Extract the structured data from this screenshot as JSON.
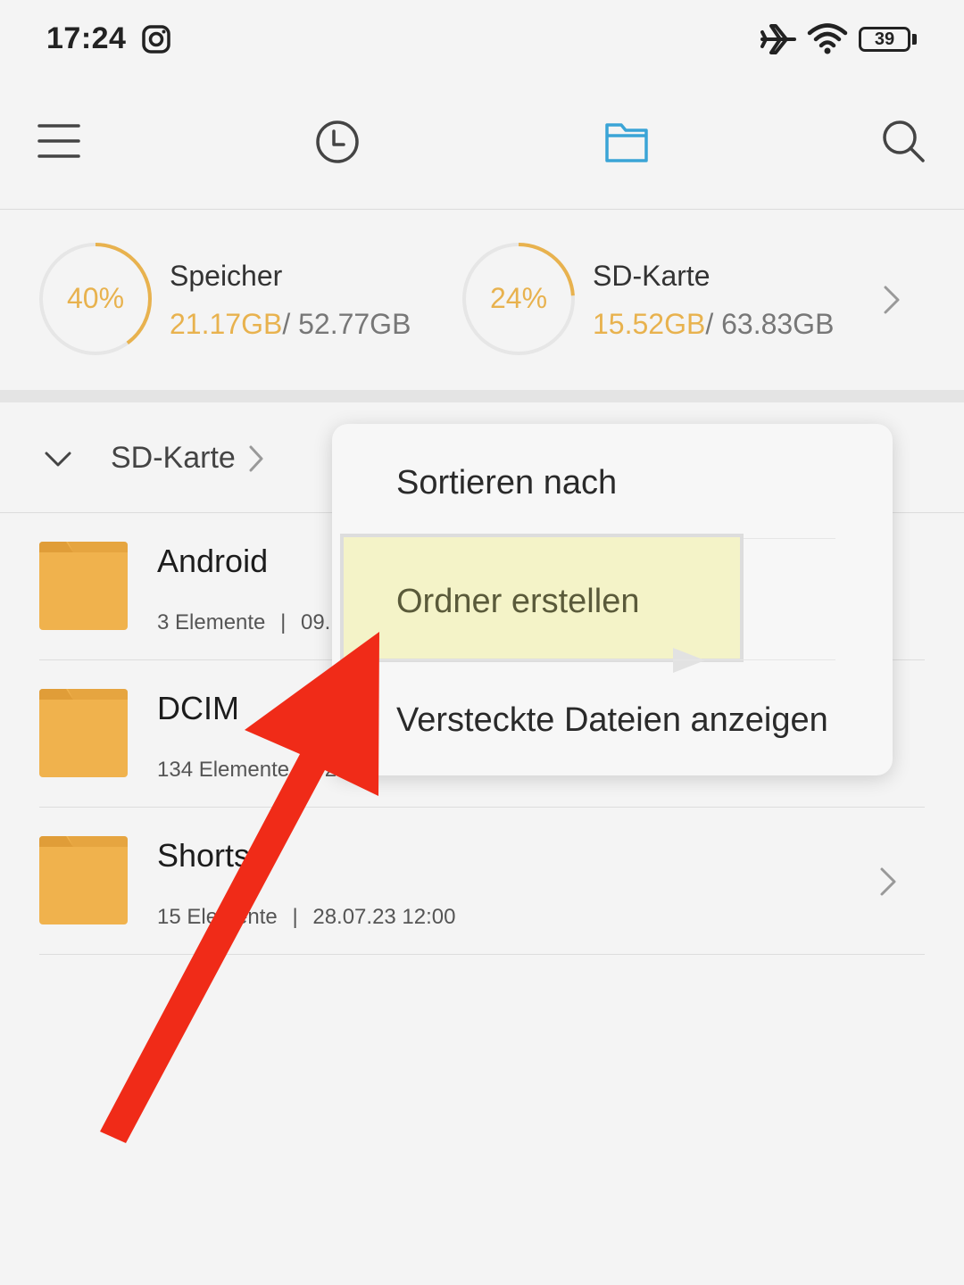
{
  "status_bar": {
    "time": "17:24",
    "battery": "39",
    "icons": [
      "instagram-icon",
      "airplane-icon",
      "wifi-icon",
      "battery-icon"
    ]
  },
  "toolbar": {
    "icons": [
      "menu-icon",
      "recent-clock-icon",
      "folder-icon",
      "search-icon"
    ],
    "active_color": "#3aa4d6"
  },
  "storage": [
    {
      "percent": "40%",
      "fill": 0.4,
      "name": "Speicher",
      "used": "21.17GB",
      "total": "/ 52.77GB"
    },
    {
      "percent": "24%",
      "fill": 0.24,
      "name": "SD-Karte",
      "used": "15.52GB",
      "total": "/ 63.83GB"
    }
  ],
  "breadcrumb": {
    "label": "SD-Karte"
  },
  "files": [
    {
      "name": "Android",
      "count": "3 Elemente",
      "sep": "|",
      "date": "09."
    },
    {
      "name": "DCIM",
      "count": "134 Elemente",
      "sep": "|",
      "date": "2"
    },
    {
      "name": "Shorts",
      "count": "15 Elemente",
      "sep": "|",
      "date": "28.07.23 12:00"
    }
  ],
  "menu": {
    "items": [
      "Sortieren nach",
      "Ordner erstellen",
      "Versteckte Dateien anzeigen"
    ],
    "highlighted_index": 1
  },
  "colors": {
    "accent": "#e8b24e",
    "folder": "#f0b24d",
    "folder_tab": "#e09d38",
    "arrow": "#f02b18",
    "highlight": "#f4f3c8"
  }
}
